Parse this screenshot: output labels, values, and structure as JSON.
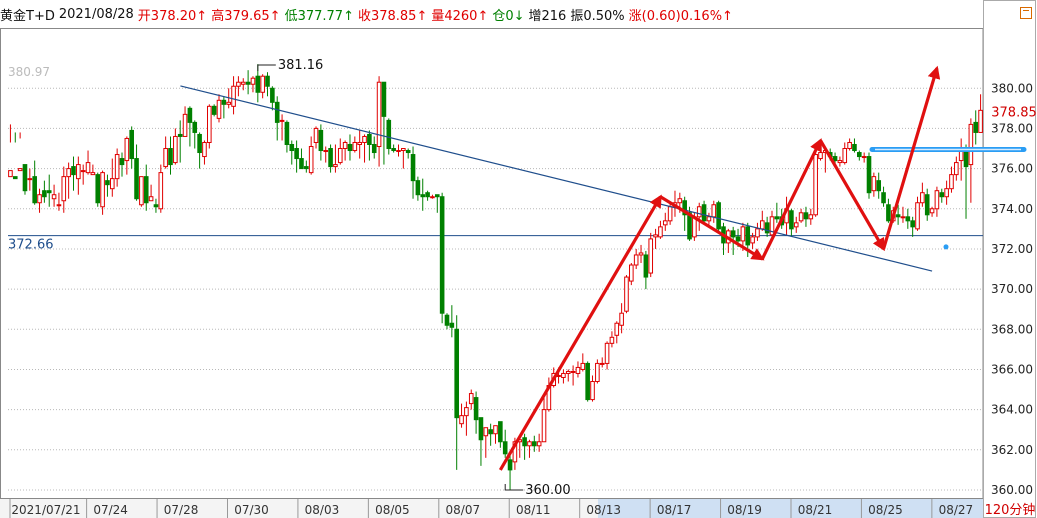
{
  "header": {
    "symbol": "黄金T+D",
    "date": "2021/08/28",
    "open": "开378.20↑",
    "high": "高379.65↑",
    "low": "低377.77↑",
    "close": "收378.85↑",
    "volume": "量4260↑",
    "position": "仓0↓",
    "increase": "增216",
    "amplitude": "振0.50%",
    "change": "涨(0.60)0.16%↑"
  },
  "period_label": "120分钟",
  "colors": {
    "up": "#e00000",
    "down": "#008000",
    "trendline": "#1f4e8c",
    "support": "#1f4e8c",
    "arrow": "#e01010",
    "resistance": "#2a9df4",
    "grid": "#b8b8b8"
  },
  "chart_data": {
    "type": "candlestick",
    "ylim": [
      359.6,
      383.0
    ],
    "y_ticks": [
      "360.00",
      "362.00",
      "364.00",
      "366.00",
      "368.00",
      "370.00",
      "372.00",
      "374.00",
      "376.00",
      "378.00",
      "380.00"
    ],
    "x_ticks": [
      "2021/07/21",
      "07/24",
      "07/28",
      "07/30",
      "08/03",
      "08/05",
      "08/07",
      "08/11",
      "08/13",
      "08/17",
      "08/19",
      "08/21",
      "08/25",
      "08/27"
    ],
    "annotations": {
      "high": "381.16",
      "low": "360.00",
      "top_left": "380.97",
      "support": "372.66",
      "current": "378.85"
    },
    "support_line": 372.66,
    "resistance_line": 376.95,
    "trendline": [
      {
        "bar": 0,
        "value": 382.2
      },
      {
        "bar": 190,
        "value": 370.9
      }
    ],
    "arrows": [
      [
        101,
        361.0
      ],
      [
        134,
        374.6
      ],
      [
        155,
        371.5
      ],
      [
        167,
        377.4
      ],
      [
        180,
        372.0
      ],
      [
        191,
        381.0
      ]
    ],
    "candles": [
      [
        375.6,
        375.9,
        377.3,
        378.2
      ],
      [
        375.6,
        375.5,
        377.3,
        377.8
      ],
      [
        375.9,
        376.0,
        377.5,
        377.8
      ],
      [
        376.2,
        374.9,
        376.1,
        374.7
      ],
      [
        375.5,
        375.5,
        376.0,
        374.9
      ],
      [
        375.6,
        374.3,
        376.4,
        374.2
      ],
      [
        374.3,
        374.7,
        375.0,
        373.8
      ],
      [
        374.9,
        374.6,
        375.4,
        374.3
      ],
      [
        374.9,
        374.8,
        375.7,
        374.1
      ],
      [
        374.5,
        374.7,
        375.2,
        374.1
      ],
      [
        374.2,
        374.2,
        374.8,
        373.9
      ],
      [
        374.4,
        375.6,
        376.1,
        373.8
      ],
      [
        375.6,
        376.0,
        376.3,
        374.5
      ],
      [
        376.1,
        375.7,
        376.6,
        374.9
      ],
      [
        375.5,
        376.2,
        376.6,
        374.7
      ],
      [
        375.9,
        375.9,
        376.2,
        375.2
      ],
      [
        375.8,
        376.3,
        376.9,
        375.7
      ],
      [
        375.7,
        375.8,
        376.2,
        375.7
      ],
      [
        375.7,
        374.3,
        375.8,
        374.1
      ],
      [
        374.1,
        375.8,
        375.9,
        373.7
      ],
      [
        375.4,
        375.2,
        375.7,
        374.6
      ],
      [
        375.0,
        375.5,
        376.5,
        374.6
      ],
      [
        375.5,
        376.7,
        377.0,
        375.1
      ],
      [
        376.5,
        376.2,
        376.8,
        375.6
      ],
      [
        376.4,
        377.5,
        377.6,
        375.7
      ],
      [
        377.9,
        376.5,
        378.1,
        376.0
      ],
      [
        376.5,
        374.5,
        377.2,
        374.4
      ],
      [
        374.2,
        375.6,
        375.6,
        374.1
      ],
      [
        375.6,
        374.3,
        376.2,
        373.9
      ],
      [
        374.4,
        374.6,
        375.2,
        374.4
      ],
      [
        374.2,
        374.1,
        374.5,
        373.8
      ],
      [
        374.0,
        375.8,
        376.2,
        373.8
      ],
      [
        376.1,
        377.0,
        377.6,
        376.0
      ],
      [
        377.0,
        376.2,
        377.6,
        375.7
      ],
      [
        376.3,
        377.6,
        378.0,
        376.2
      ],
      [
        377.7,
        377.6,
        378.4,
        376.3
      ],
      [
        377.6,
        378.7,
        379.1,
        377.6
      ],
      [
        379.0,
        378.3,
        379.1,
        377.1
      ],
      [
        378.3,
        377.8,
        378.4,
        377.0
      ],
      [
        377.7,
        376.8,
        377.8,
        376.0
      ],
      [
        376.6,
        377.3,
        377.4,
        376.2
      ],
      [
        377.3,
        379.1,
        379.2,
        377.0
      ],
      [
        379.1,
        378.7,
        379.2,
        378.6
      ],
      [
        378.5,
        379.4,
        379.7,
        378.3
      ],
      [
        379.4,
        379.2,
        379.6,
        378.5
      ],
      [
        379.2,
        379.3,
        380.0,
        379.0
      ],
      [
        379.1,
        380.1,
        380.6,
        378.7
      ],
      [
        380.1,
        380.3,
        380.6,
        379.6
      ],
      [
        380.2,
        380.3,
        380.5,
        379.9
      ],
      [
        380.3,
        380.2,
        380.9,
        379.7
      ],
      [
        380.2,
        380.5,
        380.6,
        379.8
      ],
      [
        380.6,
        379.8,
        381.2,
        379.3
      ],
      [
        379.8,
        380.6,
        380.7,
        379.5
      ],
      [
        380.6,
        380.1,
        380.8,
        379.6
      ],
      [
        380.0,
        379.3,
        380.1,
        378.9
      ],
      [
        379.3,
        378.3,
        379.6,
        377.4
      ],
      [
        378.4,
        378.4,
        378.7,
        377.4
      ],
      [
        378.3,
        377.2,
        378.4,
        376.8
      ],
      [
        377.2,
        376.9,
        377.4,
        376.2
      ],
      [
        377.0,
        376.5,
        377.4,
        375.8
      ],
      [
        376.5,
        376.0,
        377.0,
        376.0
      ],
      [
        376.1,
        376.0,
        376.4,
        375.8
      ],
      [
        375.8,
        377.1,
        377.6,
        375.7
      ],
      [
        377.3,
        378.0,
        378.1,
        377.0
      ],
      [
        377.9,
        376.9,
        378.2,
        376.4
      ],
      [
        376.9,
        376.9,
        377.1,
        376.3
      ],
      [
        377.0,
        376.1,
        377.2,
        375.8
      ],
      [
        376.1,
        376.2,
        377.2,
        375.8
      ],
      [
        376.3,
        377.0,
        377.5,
        376.2
      ],
      [
        377.0,
        377.3,
        377.4,
        376.4
      ],
      [
        377.2,
        376.9,
        377.7,
        376.4
      ],
      [
        376.9,
        377.3,
        377.6,
        376.8
      ],
      [
        377.2,
        377.3,
        377.9,
        376.5
      ],
      [
        377.3,
        377.6,
        377.7,
        376.3
      ],
      [
        377.7,
        377.2,
        377.9,
        376.4
      ],
      [
        377.2,
        376.8,
        377.6,
        376.5
      ],
      [
        377.1,
        380.3,
        380.6,
        376.1
      ],
      [
        380.3,
        378.6,
        380.3,
        376.2
      ],
      [
        378.4,
        377.0,
        378.5,
        376.7
      ],
      [
        377.0,
        376.9,
        377.2,
        376.8
      ],
      [
        376.9,
        376.9,
        377.2,
        376.6
      ],
      [
        376.9,
        377.0,
        377.0,
        376.0
      ],
      [
        376.9,
        376.8,
        377.0,
        376.5
      ],
      [
        376.7,
        375.4,
        377.1,
        374.5
      ],
      [
        375.4,
        374.7,
        375.6,
        374.4
      ],
      [
        374.7,
        374.6,
        375.5,
        373.9
      ],
      [
        374.8,
        374.6,
        374.9,
        374.4
      ],
      [
        374.6,
        374.6,
        374.7,
        374.5
      ],
      [
        374.7,
        374.6,
        374.7,
        373.8
      ],
      [
        374.6,
        368.8,
        374.8,
        368.3
      ],
      [
        368.7,
        368.2,
        368.8,
        368.0
      ],
      [
        368.3,
        368.1,
        369.2,
        367.6
      ],
      [
        368.0,
        363.6,
        368.7,
        361.0
      ],
      [
        363.3,
        363.7,
        364.3,
        363.1
      ],
      [
        363.7,
        364.1,
        364.4,
        362.7
      ],
      [
        364.3,
        364.8,
        365.0,
        364.0
      ],
      [
        364.6,
        363.5,
        364.9,
        362.8
      ],
      [
        363.6,
        362.5,
        363.6,
        361.2
      ],
      [
        362.7,
        363.1,
        363.1,
        361.6
      ],
      [
        363.0,
        362.8,
        363.3,
        362.2
      ],
      [
        362.8,
        363.2,
        363.2,
        362.3
      ],
      [
        363.4,
        362.4,
        363.4,
        362.1
      ],
      [
        362.4,
        361.8,
        363.0,
        361.6
      ],
      [
        361.5,
        361.0,
        361.8,
        360.0
      ],
      [
        361.4,
        362.4,
        362.6,
        361.0
      ],
      [
        362.4,
        362.5,
        362.7,
        361.6
      ],
      [
        362.6,
        362.2,
        362.8,
        361.5
      ],
      [
        362.2,
        362.4,
        362.5,
        361.6
      ],
      [
        362.4,
        362.2,
        362.7,
        361.9
      ],
      [
        362.2,
        362.4,
        362.8,
        361.9
      ],
      [
        362.4,
        364.0,
        364.8,
        362.4
      ],
      [
        364.0,
        365.2,
        365.6,
        363.9
      ],
      [
        365.2,
        365.8,
        366.1,
        365.1
      ],
      [
        365.7,
        365.7,
        366.1,
        365.3
      ],
      [
        365.6,
        365.8,
        366.0,
        365.3
      ],
      [
        365.8,
        365.9,
        366.0,
        365.4
      ],
      [
        365.9,
        365.9,
        366.2,
        365.2
      ],
      [
        365.8,
        366.1,
        366.4,
        365.6
      ],
      [
        366.0,
        366.3,
        366.8,
        365.9
      ],
      [
        366.3,
        364.5,
        366.4,
        364.4
      ],
      [
        364.5,
        365.4,
        365.7,
        364.4
      ],
      [
        365.4,
        366.3,
        366.5,
        365.3
      ],
      [
        366.3,
        366.3,
        366.6,
        366.1
      ],
      [
        366.3,
        367.3,
        367.4,
        366.0
      ],
      [
        367.3,
        367.6,
        367.9,
        367.1
      ],
      [
        367.7,
        368.3,
        368.4,
        367.3
      ],
      [
        368.2,
        368.8,
        369.3,
        367.8
      ],
      [
        368.9,
        370.6,
        370.7,
        368.8
      ],
      [
        370.4,
        371.2,
        371.3,
        370.2
      ],
      [
        371.2,
        371.7,
        372.0,
        371.0
      ],
      [
        371.7,
        371.8,
        372.2,
        371.3
      ],
      [
        371.7,
        370.6,
        371.9,
        370.0
      ],
      [
        370.8,
        372.5,
        372.8,
        370.6
      ],
      [
        372.6,
        372.7,
        373.0,
        372.0
      ],
      [
        372.6,
        373.1,
        373.4,
        372.5
      ],
      [
        373.2,
        373.4,
        373.8,
        372.9
      ],
      [
        373.4,
        374.1,
        374.3,
        373.2
      ],
      [
        374.1,
        374.3,
        374.9,
        373.6
      ],
      [
        374.3,
        374.5,
        374.8,
        373.8
      ],
      [
        374.4,
        373.7,
        374.6,
        372.9
      ],
      [
        373.8,
        372.5,
        374.1,
        372.4
      ],
      [
        372.6,
        373.6,
        373.8,
        372.4
      ],
      [
        373.6,
        374.1,
        374.3,
        372.9
      ],
      [
        374.2,
        373.4,
        374.4,
        373.2
      ],
      [
        373.4,
        373.6,
        373.8,
        373.2
      ],
      [
        373.6,
        374.2,
        374.4,
        373.3
      ],
      [
        374.3,
        373.0,
        374.4,
        372.9
      ],
      [
        373.1,
        372.3,
        373.3,
        371.7
      ],
      [
        372.3,
        372.9,
        373.0,
        371.8
      ],
      [
        372.9,
        372.6,
        373.1,
        371.7
      ],
      [
        372.6,
        372.4,
        373.0,
        372.1
      ],
      [
        372.4,
        373.1,
        373.3,
        371.9
      ],
      [
        373.1,
        372.2,
        373.3,
        371.6
      ],
      [
        372.3,
        372.6,
        372.8,
        372.0
      ],
      [
        372.6,
        373.0,
        373.3,
        372.4
      ],
      [
        373.0,
        373.4,
        373.9,
        372.9
      ],
      [
        373.3,
        372.8,
        373.6,
        372.6
      ],
      [
        372.7,
        373.6,
        373.9,
        372.5
      ],
      [
        373.6,
        373.5,
        374.3,
        373.3
      ],
      [
        373.6,
        373.2,
        374.0,
        373.0
      ],
      [
        373.3,
        374.0,
        374.6,
        372.7
      ],
      [
        373.9,
        373.0,
        374.0,
        372.6
      ],
      [
        373.1,
        373.3,
        373.6,
        372.8
      ],
      [
        373.4,
        373.8,
        374.0,
        373.3
      ],
      [
        373.8,
        373.5,
        374.1,
        373.1
      ],
      [
        373.5,
        373.7,
        374.0,
        373.2
      ],
      [
        373.7,
        376.7,
        377.2,
        373.6
      ],
      [
        376.5,
        376.8,
        377.2,
        376.4
      ],
      [
        376.8,
        376.9,
        377.0,
        375.8
      ],
      [
        376.8,
        376.6,
        377.0,
        376.4
      ],
      [
        376.6,
        376.4,
        376.8,
        376.1
      ],
      [
        376.3,
        376.4,
        376.6,
        376.1
      ],
      [
        376.3,
        377.0,
        377.3,
        376.2
      ],
      [
        377.0,
        377.3,
        377.5,
        376.9
      ],
      [
        377.2,
        376.9,
        377.5,
        376.8
      ],
      [
        376.8,
        376.6,
        376.9,
        376.4
      ],
      [
        376.6,
        376.6,
        376.8,
        376.3
      ],
      [
        376.6,
        374.8,
        376.8,
        374.5
      ],
      [
        374.9,
        375.6,
        375.8,
        374.6
      ],
      [
        375.4,
        374.9,
        375.8,
        374.5
      ],
      [
        374.8,
        374.3,
        375.1,
        374.1
      ],
      [
        374.2,
        373.4,
        374.5,
        373.3
      ],
      [
        373.4,
        373.9,
        374.1,
        373.3
      ],
      [
        373.7,
        373.6,
        374.2,
        373.2
      ],
      [
        373.6,
        373.6,
        374.1,
        373.3
      ],
      [
        373.6,
        373.4,
        374.0,
        373.0
      ],
      [
        373.4,
        373.1,
        373.6,
        372.6
      ],
      [
        373.0,
        374.3,
        374.6,
        372.9
      ],
      [
        374.3,
        374.8,
        375.3,
        374.1
      ],
      [
        374.7,
        373.7,
        375.0,
        373.4
      ],
      [
        373.8,
        374.0,
        374.1,
        373.6
      ],
      [
        374.0,
        374.9,
        375.1,
        373.6
      ],
      [
        374.8,
        374.6,
        375.0,
        374.3
      ],
      [
        374.6,
        375.0,
        375.4,
        374.2
      ],
      [
        375.0,
        375.7,
        376.1,
        374.8
      ],
      [
        375.7,
        376.3,
        376.6,
        375.4
      ],
      [
        376.4,
        377.0,
        377.5,
        375.4
      ],
      [
        377.0,
        376.1,
        377.2,
        373.5
      ],
      [
        376.2,
        378.2,
        378.5,
        374.3
      ],
      [
        378.3,
        377.8,
        378.9,
        377.2
      ],
      [
        377.8,
        378.9,
        379.7,
        377.8
      ]
    ]
  }
}
